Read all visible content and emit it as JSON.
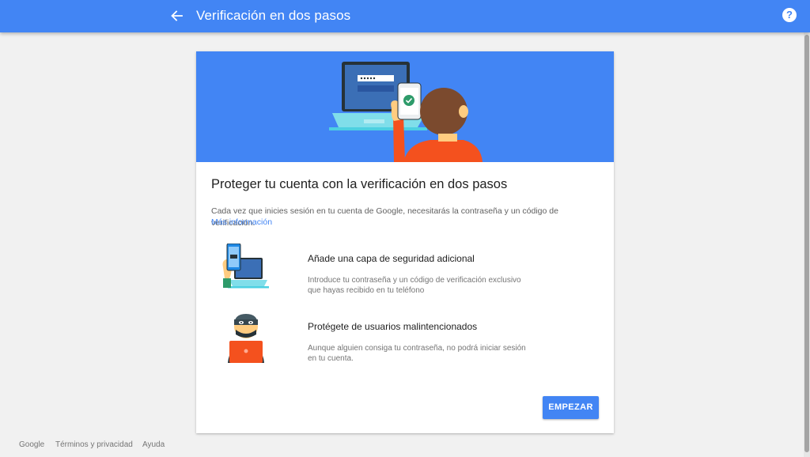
{
  "topbar": {
    "title": "Verificación en dos pasos",
    "back_icon": "arrow-back-icon",
    "help_icon": "help-icon",
    "help_glyph": "?"
  },
  "card": {
    "heading": "Proteger tu cuenta con la verificación en dos pasos",
    "description": "Cada vez que inicies sesión en tu cuenta de Google, necesitarás la contraseña y un código de verificación.",
    "more_link": "Más información",
    "features": [
      {
        "icon": "phone-laptop-icon",
        "title": "Añade una capa de seguridad adicional",
        "description_line1": "Introduce tu contraseña y un código de verificación exclusivo",
        "description_line2": "que hayas recibido en tu teléfono"
      },
      {
        "icon": "masked-intruder-icon",
        "title": "Protégete de usuarios malintencionados",
        "description_line1": "Aunque alguien consiga tu contraseña, no podrá iniciar sesión",
        "description_line2": "en tu cuenta."
      }
    ],
    "start_button": "EMPEZAR"
  },
  "footer": {
    "links": [
      "Google",
      "Términos y privacidad",
      "Ayuda"
    ]
  },
  "colors": {
    "primary": "#4285f4",
    "background": "#f1f1f1",
    "card": "#ffffff"
  }
}
